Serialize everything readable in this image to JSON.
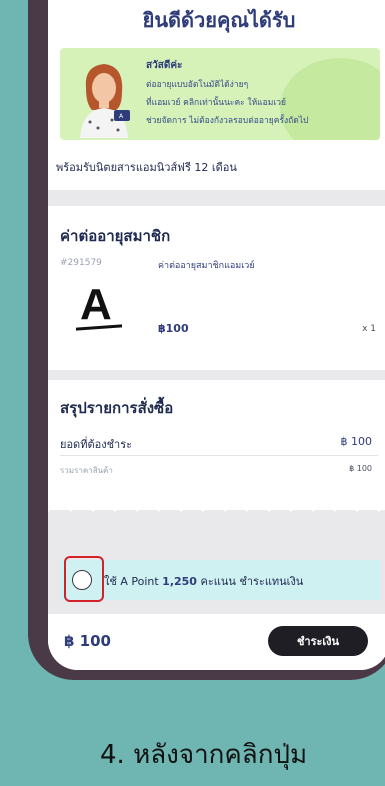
{
  "welcome": {
    "title": "ยินดีด้วยคุณได้รับ",
    "hello": "สวัสดีค่ะ",
    "lines": [
      "ต่ออายุแบบอัตโนมัติได้ง่ายๆ",
      "ที่แอมเวย์ คลิกเท่านั้นนะคะ ให้แอมเวย์",
      "ช่วยจัดการ ไม่ต้องกังวลรอบต่ออายุครั้งถัดไป"
    ],
    "promo": "พร้อมรับนิตยสารแอมนิวส์ฟรี 12 เดือน"
  },
  "membership": {
    "title": "ค่าต่ออายุสมาชิก",
    "code": "#291579",
    "item_name": "ค่าต่ออายุสมาชิกแอมเวย์",
    "logo": "A",
    "price": "฿100",
    "qty": "x 1"
  },
  "summary": {
    "title": "สรุปรายการสั่งซื้อ",
    "due_label": "ยอดที่ต้องชำระ",
    "due_value": "฿ 100",
    "subtotal_label": "รวมราคาสินค้า",
    "subtotal_value": "฿ 100"
  },
  "apoint": {
    "prefix": "ใช้ A Point",
    "amount": "1,250",
    "suffix": "คะแนน ชำระแทนเงิน"
  },
  "footer": {
    "total": "฿ 100",
    "pay_label": "ชำระเงิน"
  },
  "caption": "4. หลังจากคลิกปุ่ม",
  "colors": {
    "background": "#6fb5b2",
    "accent": "#2f3c7a",
    "banner": "#d6f2b8",
    "apoint_bg": "#cff1f2",
    "highlight": "#d3222a"
  }
}
